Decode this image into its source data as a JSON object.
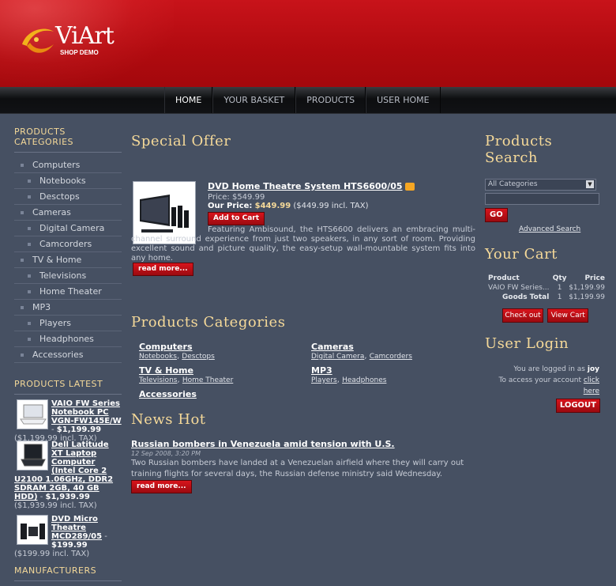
{
  "header": {
    "logo_main": "ViArt",
    "logo_sub": "SHOP DEMO"
  },
  "nav": {
    "items": [
      "HOME",
      "YOUR BASKET",
      "PRODUCTS",
      "USER HOME"
    ]
  },
  "left": {
    "categories_title": "PRODUCTS CATEGORIES",
    "categories": [
      {
        "label": "Computers",
        "level": 1
      },
      {
        "label": "Notebooks",
        "level": 2
      },
      {
        "label": "Desctops",
        "level": 2
      },
      {
        "label": "Cameras",
        "level": 1
      },
      {
        "label": "Digital Camera",
        "level": 2
      },
      {
        "label": "Camcorders",
        "level": 2
      },
      {
        "label": "TV & Home",
        "level": 1
      },
      {
        "label": "Televisions",
        "level": 2
      },
      {
        "label": "Home Theater",
        "level": 2
      },
      {
        "label": "MP3",
        "level": 1
      },
      {
        "label": "Players",
        "level": 2
      },
      {
        "label": "Headphones",
        "level": 2
      },
      {
        "label": "Accessories",
        "level": 1
      }
    ],
    "latest_title": "PRODUCTS LATEST",
    "latest": [
      {
        "name": "VAIO FW Series Notebook PC VGN-FW145E/W",
        "price": "$1,199.99",
        "incl": "($1,199.99 incl. TAX)"
      },
      {
        "name": "Dell Latitude XT Laptop Computer (Intel Core 2 U2100 1.06GHz, DDR2 SDRAM 2GB, 40 GB HDD)",
        "price": "$1,939.99",
        "incl": "($1,939.99 incl. TAX)"
      },
      {
        "name": "DVD Micro Theatre MCD289/05",
        "price": "$199.99",
        "incl": "($199.99 incl. TAX)"
      }
    ],
    "manufacturers_title": "MANUFACTURERS"
  },
  "offer": {
    "title": "Special Offer",
    "product_name": "DVD Home Theatre System HTS6600/05",
    "price_label": "Price:",
    "price": "$549.99",
    "our_price_label": "Our Price:",
    "our_price": "$449.99",
    "our_price_incl": "($449.99 incl. TAX)",
    "add_to_cart": "Add to Cart",
    "description": "Featuring Ambisound, the HTS6600 delivers an embracing multi-channel surround experience from just two speakers, in any sort of room. Providing excellent sound and picture quality, the easy-setup wall-mountable system fits into any home.",
    "read_more": "read more..."
  },
  "categories_block": {
    "title": "Products Categories",
    "groups": [
      {
        "name": "Computers",
        "subs": [
          "Notebooks",
          "Desctops"
        ]
      },
      {
        "name": "Cameras",
        "subs": [
          "Digital Camera",
          "Camcorders"
        ]
      },
      {
        "name": "TV & Home",
        "subs": [
          "Televisions",
          "Home Theater"
        ]
      },
      {
        "name": "MP3",
        "subs": [
          "Players",
          "Headphones"
        ]
      },
      {
        "name": "Accessories",
        "subs": []
      }
    ]
  },
  "news": {
    "title": "News Hot",
    "headline": "Russian bombers in Venezuela amid tension with U.S.",
    "date": "12 Sep 2008, 3:20 PM",
    "body": "Two Russian bombers have landed at a Venezuelan airfield where they will carry out training flights for several days, the Russian defense ministry said Wednesday.",
    "read_more": "read more..."
  },
  "search": {
    "title": "Products Search",
    "select_value": "All Categories",
    "go": "GO",
    "advanced": "Advanced Search"
  },
  "cart": {
    "title": "Your Cart",
    "headers": [
      "Product",
      "Qty",
      "Price"
    ],
    "item": {
      "name": "VAIO FW Series...",
      "qty": "1",
      "price": "$1,199.99"
    },
    "goods_total_label": "Goods Total",
    "goods_total_qty": "1",
    "goods_total_price": "$1,199.99",
    "checkout": "Check out",
    "view_cart": "View Cart"
  },
  "login": {
    "title": "User Login",
    "logged_in_text": "You are logged in as",
    "user": "joy",
    "access_text": "To access your account",
    "click_here": "click here",
    "logout": "LOGOUT"
  }
}
